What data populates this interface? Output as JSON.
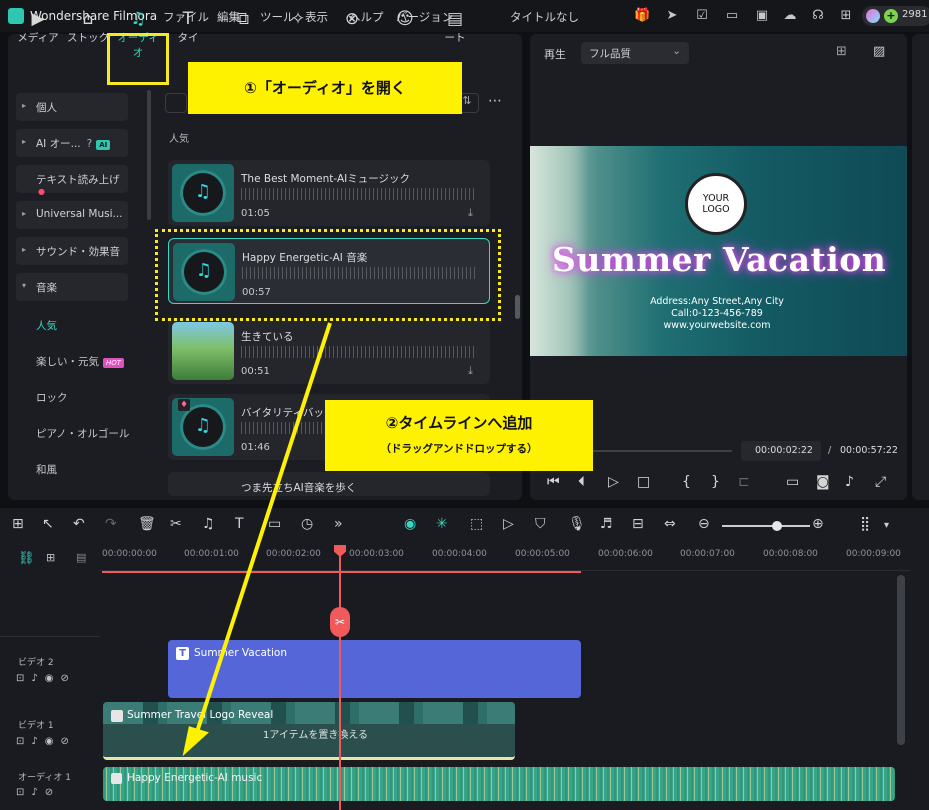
{
  "app": {
    "name": "Wondershare Filmora",
    "title": "タイトルなし",
    "credits": "2981"
  },
  "menu": [
    "ファイル",
    "編集",
    "ツール",
    "表示",
    "ヘルプ",
    "バージョン"
  ],
  "toolbar_tabs": [
    "メディア",
    "ストック",
    "オーディオ",
    "タイ",
    "",
    "",
    "",
    "",
    "ート"
  ],
  "sidebar": {
    "items": [
      {
        "label": "個人",
        "type": "cat"
      },
      {
        "label": "AI オー...",
        "type": "cat",
        "badge": "AI"
      },
      {
        "label": "テキスト読み上げ",
        "type": "cat"
      },
      {
        "label": "Universal Musi...",
        "type": "cat"
      },
      {
        "label": "サウンド・効果音",
        "type": "cat"
      },
      {
        "label": "音楽",
        "type": "cat",
        "expanded": true
      }
    ],
    "subitems": [
      "人気",
      "楽しい・元気",
      "ロック",
      "ピアノ・オルゴール",
      "和風"
    ],
    "hot_badge": "HOT"
  },
  "section_title": "人気",
  "tracks": [
    {
      "name": "The Best Moment-AIミュージック",
      "duration": "01:05"
    },
    {
      "name": "Happy Energetic-AI 音楽",
      "duration": "00:57"
    },
    {
      "name": "生きている",
      "duration": "00:51"
    },
    {
      "name": "バイタリティバップ",
      "duration": "01:46"
    },
    {
      "name": "つま先立ちAI音楽を歩く",
      "duration": ""
    }
  ],
  "callouts": {
    "step1": "①「オーディオ」を開く",
    "step2": "②タイムラインへ追加",
    "step2_sub": "（ドラッグアンドドロップする）"
  },
  "preview": {
    "label": "再生",
    "quality": "フル品質",
    "logo_line1": "YOUR",
    "logo_line2": "LOGO",
    "headline": "Summer Vacation",
    "address": "Address:Any Street,Any City",
    "call": "Call:0-123-456-789",
    "website": "www.yourwebsite.com",
    "current_time": "00:00:02:22",
    "total_time": "00:00:57:22"
  },
  "timeline": {
    "ruler": [
      "00:00:00:00",
      "00:00:01:00",
      "00:00:02:00",
      "00:00:03:00",
      "00:00:04:00",
      "00:00:05:00",
      "00:00:06:00",
      "00:00:07:00",
      "00:00:08:00",
      "00:00:09:00"
    ],
    "tracks": {
      "video2": "ビデオ 2",
      "video1": "ビデオ 1",
      "audio1": "オーディオ 1"
    },
    "clip_text": "Summer Vacation",
    "clip_video": "Summer Travel Logo Reveal",
    "replace_hint": "1アイテムを置き換える",
    "clip_audio": "Happy Energetic-AI music"
  },
  "colors": {
    "accent": "#37d8c4",
    "callout": "#fff200",
    "playhead": "#f05a5a",
    "text_clip": "#5567d8",
    "audio_clip": "#39a488"
  }
}
